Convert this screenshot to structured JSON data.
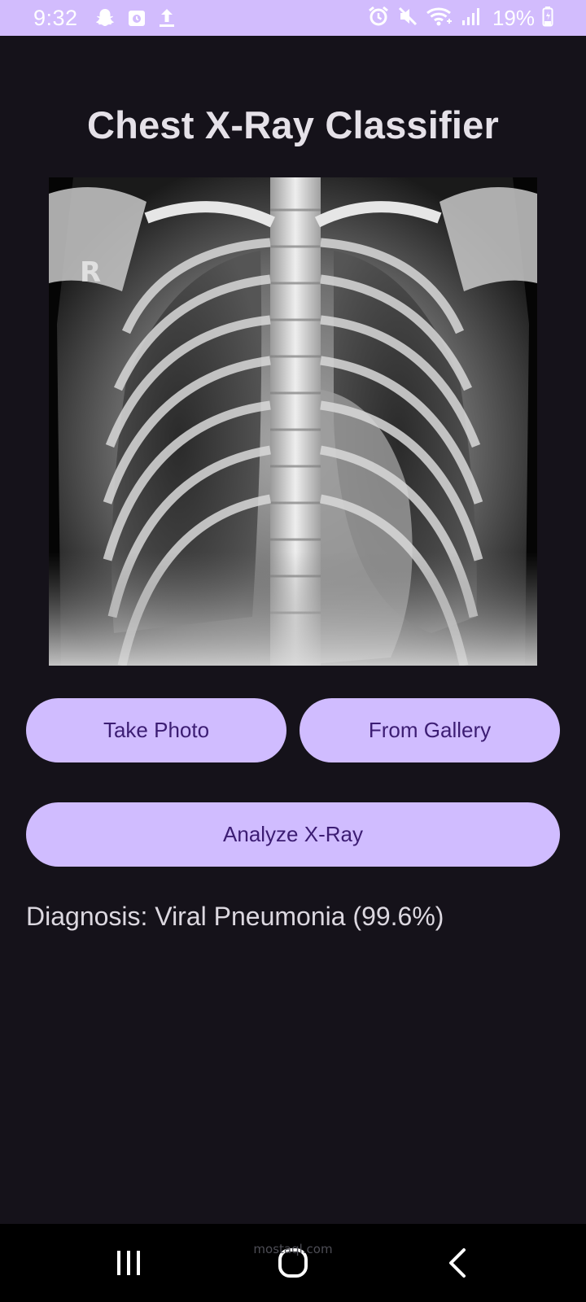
{
  "status_bar": {
    "time": "9:32",
    "battery_text": "19%",
    "left_icons": [
      "snapchat-icon",
      "calendar-notification-icon",
      "upload-icon"
    ],
    "right_icons": [
      "alarm-icon",
      "mute-icon",
      "wifi-icon",
      "signal-icon",
      "battery-icon"
    ]
  },
  "app": {
    "title": "Chest X-Ray Classifier",
    "image_alt_letter": "R",
    "buttons": {
      "take_photo": "Take Photo",
      "from_gallery": "From Gallery",
      "analyze": "Analyze X-Ray"
    },
    "diagnosis_text": "Diagnosis: Viral Pneumonia (99.6%)"
  },
  "nav_bar": {
    "watermark": "mostaql.com",
    "buttons": [
      "recents-icon",
      "home-icon",
      "back-icon"
    ]
  },
  "colors": {
    "status_bar_bg": "#d2bcfd",
    "background": "#15121a",
    "button_bg": "#d0bcff",
    "button_text": "#3c1d73",
    "title_text": "#e5e1e8"
  }
}
